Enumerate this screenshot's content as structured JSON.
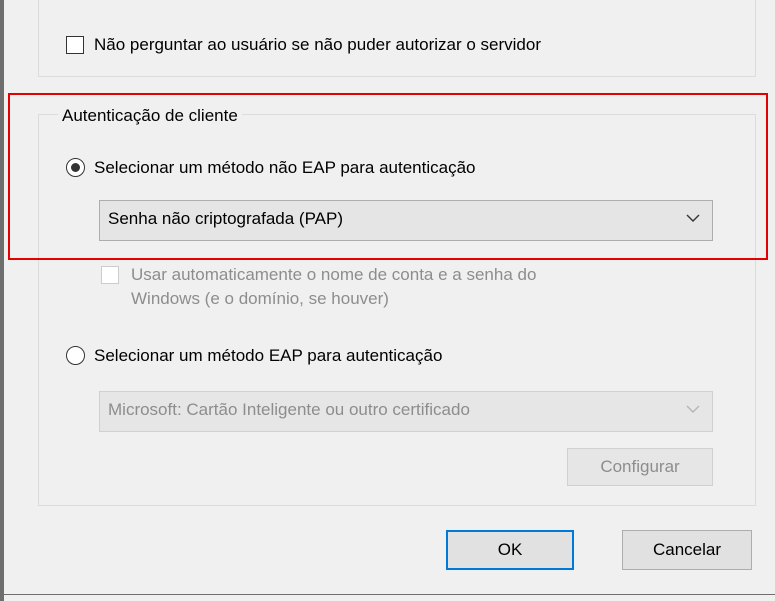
{
  "server_section": {
    "dont_prompt_checkbox": {
      "label": "Não perguntar ao usuário se não puder autorizar o servidor",
      "checked": false
    }
  },
  "client_auth": {
    "legend": "Autenticação de cliente",
    "non_eap_radio": {
      "label": "Selecionar um método não EAP para autenticação",
      "selected": true
    },
    "non_eap_dropdown": {
      "value": "Senha não criptografada (PAP)"
    },
    "windows_credentials_checkbox": {
      "label_line1": "Usar automaticamente o nome de conta e a senha do",
      "label_line2": "Windows (e o domínio, se houver)",
      "checked": false,
      "enabled": false
    },
    "eap_radio": {
      "label": "Selecionar um método EAP para autenticação",
      "selected": false
    },
    "eap_dropdown": {
      "value": "Microsoft: Cartão Inteligente ou outro certificado",
      "enabled": false
    },
    "configure_button": {
      "label": "Configurar",
      "enabled": false
    }
  },
  "footer": {
    "ok_label": "OK",
    "cancel_label": "Cancelar"
  },
  "colors": {
    "dialog_bg": "#f0f0f0",
    "highlight": "#e30000",
    "default_button_border": "#0078d7",
    "disabled_text": "#8d8d8d"
  },
  "icons": {
    "dropdown_arrow": "chevron-down-icon"
  }
}
